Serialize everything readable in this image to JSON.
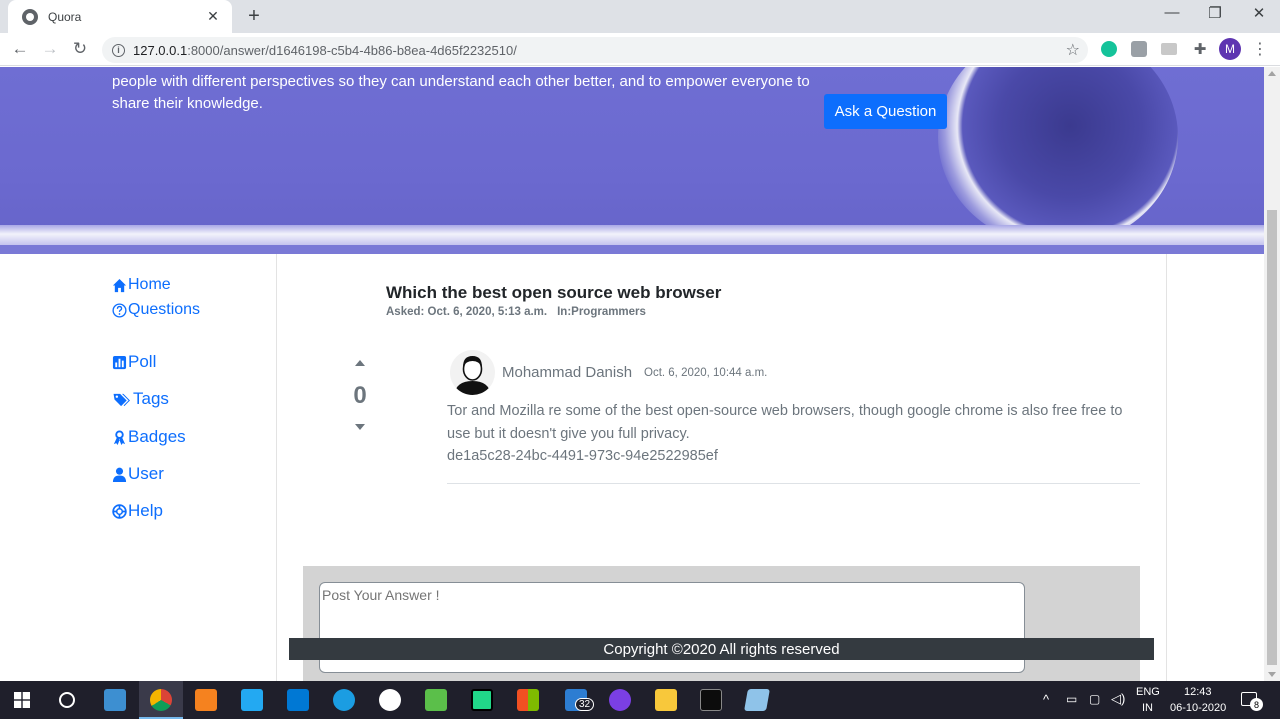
{
  "browser": {
    "tab_title": "Quora",
    "tab_close": "✕",
    "new_tab": "+",
    "url_host": "127.0.0.1",
    "url_path": ":8000/answer/d1646198-c5b4-4b86-b8ea-4d65f2232510/",
    "profile_initial": "M",
    "window_controls": {
      "minimize": "—",
      "maximize": "❐",
      "close": "✕"
    }
  },
  "hero": {
    "tagline": "people with different perspectives so they can understand each other better, and to empower everyone to share their knowledge.",
    "ask_button": "Ask a Question"
  },
  "sidebar": {
    "items": [
      {
        "label": "Home",
        "icon": "home-icon"
      },
      {
        "label": "Questions",
        "icon": "question-circle-icon"
      },
      {
        "label": "Poll",
        "icon": "poll-icon"
      },
      {
        "label": "Tags",
        "icon": "tags-icon"
      },
      {
        "label": "Badges",
        "icon": "ribbon-icon"
      },
      {
        "label": "User",
        "icon": "user-icon"
      },
      {
        "label": "Help",
        "icon": "lifebuoy-icon"
      }
    ]
  },
  "question": {
    "title": "Which the best open source web browser",
    "asked": "Asked: Oct. 6, 2020, 5:13 a.m.",
    "category": "In:Programmers"
  },
  "answer": {
    "votes": "0",
    "author": "Mohammad Danish",
    "date": "Oct. 6, 2020, 10:44 a.m.",
    "body": "Tor and Mozilla re some of the best open-source web browsers, though google chrome is also free free to use but it doesn't give you full privacy.",
    "id_line": "de1a5c28-24bc-4491-973c-94e2522985ef"
  },
  "answer_form": {
    "placeholder": "Post Your Answer !"
  },
  "footer": {
    "text": "Copyright ©2020 All rights reserved"
  },
  "taskbar": {
    "language_top": "ENG",
    "language_bottom": "IN",
    "time": "12:43",
    "date": "06-10-2020",
    "badge_count": "32",
    "notification_count": "8"
  },
  "colors": {
    "accent": "#0d6efd",
    "hero": "#6f6ed3",
    "footer": "#343a40"
  }
}
